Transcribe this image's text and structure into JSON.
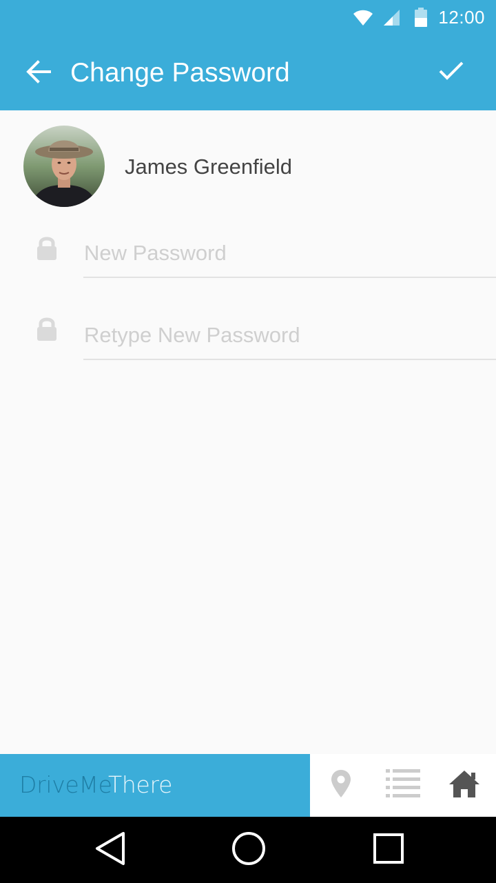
{
  "status_bar": {
    "time": "12:00",
    "icons": [
      "wifi-icon",
      "cell-signal-icon",
      "battery-icon"
    ]
  },
  "app_bar": {
    "back_icon": "arrow-back-icon",
    "title": "Change Password",
    "confirm_icon": "check-icon"
  },
  "profile": {
    "name": "James Greenfield",
    "avatar": "user-avatar-photo"
  },
  "form": {
    "new_password": {
      "value": "",
      "placeholder": "New Password",
      "icon": "lock-icon"
    },
    "retype_password": {
      "value": "",
      "placeholder": "Retype New Password",
      "icon": "lock-icon"
    }
  },
  "brand_bar": {
    "brand_part1": "DriveMe",
    "brand_part2": "There"
  },
  "bottom_nav": {
    "items": [
      {
        "icon": "location-pin-icon"
      },
      {
        "icon": "list-icon"
      },
      {
        "icon": "home-icon"
      }
    ]
  },
  "system_nav": {
    "items": [
      "back-triangle-icon",
      "home-circle-icon",
      "recents-square-icon"
    ]
  },
  "colors": {
    "primary": "#3badd9",
    "brand_dark": "#1f7ea5",
    "background": "#fafafa",
    "placeholder": "#cfcfcf",
    "divider": "#e2e2e2"
  }
}
